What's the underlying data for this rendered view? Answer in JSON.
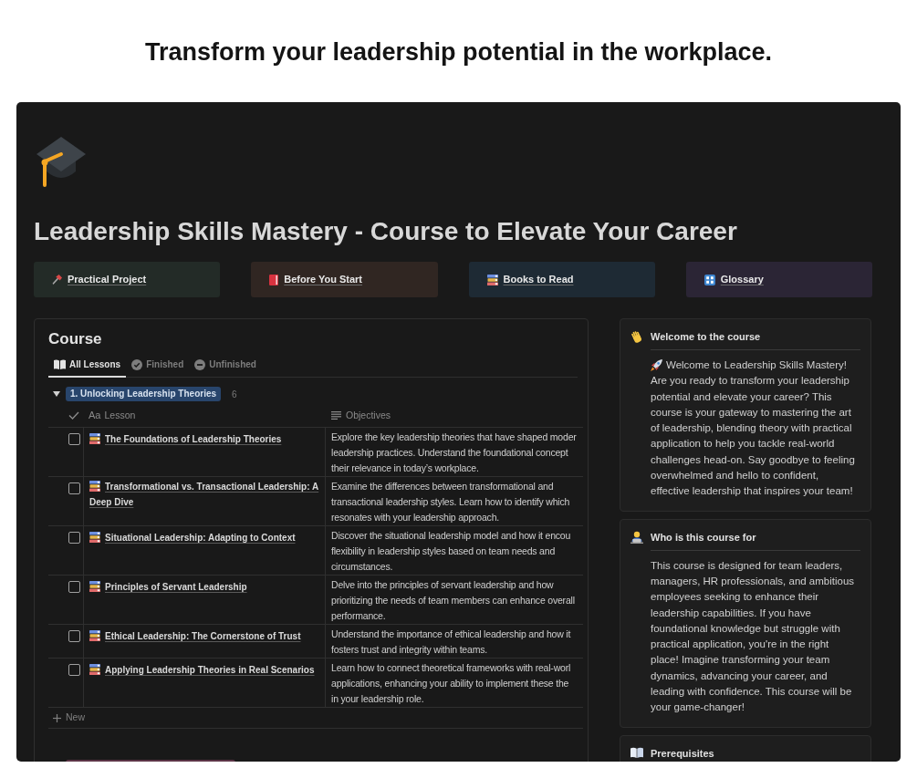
{
  "heading": "Transform your leadership potential in the workplace.",
  "title": "Leadership Skills Mastery - Course to Elevate Your Career",
  "links": [
    {
      "label": "Practical Project",
      "color": "#232b27"
    },
    {
      "label": "Before You Start",
      "color": "#302622"
    },
    {
      "label": "Books to Read",
      "color": "#1e2a34"
    },
    {
      "label": "Glossary",
      "color": "#2b2535"
    }
  ],
  "course": {
    "title": "Course",
    "tabs": [
      {
        "label": "All Lessons",
        "selected": true
      },
      {
        "label": "Finished",
        "selected": false
      },
      {
        "label": "Unfinished",
        "selected": false
      }
    ],
    "columns": [
      {
        "glyph": "Aa",
        "label": "Lesson"
      },
      {
        "label": "Objectives"
      }
    ],
    "groups": [
      {
        "label": "1. Unlocking Leadership Theories",
        "count": "6",
        "expanded": true,
        "color": "#28456c",
        "rows": [
          {
            "checked": false,
            "lesson": "The Foundations of Leadership Theories",
            "objectives": "Explore the key leadership theories that have shaped moder\nleadership practices. Understand the foundational concept\ntheir relevance in today’s workplace."
          },
          {
            "checked": false,
            "lesson": "Transformational vs. Transactional Leadership: A Deep Dive",
            "objectives": "Examine the differences between transformational and\ntransactional leadership styles. Learn how to identify which\nresonates with your leadership approach."
          },
          {
            "checked": false,
            "lesson": "Situational Leadership: Adapting to Context",
            "objectives": "Discover the situational leadership model and how it encou\nflexibility in leadership styles based on team needs and\ncircumstances."
          },
          {
            "checked": false,
            "lesson": "Principles of Servant Leadership",
            "objectives": "Delve into the principles of servant leadership and how\nprioritizing the needs of team members can enhance overall\nperformance."
          },
          {
            "checked": false,
            "lesson": "Ethical Leadership: The Cornerstone of Trust",
            "objectives": "Understand the importance of ethical leadership and how it\nfosters trust and integrity within teams."
          },
          {
            "checked": false,
            "lesson": "Applying Leadership Theories in Real Scenarios",
            "objectives": "Learn how to connect theoretical frameworks with real-worl\napplications, enhancing your ability to implement these the\nin your leadership role."
          }
        ]
      },
      {
        "color": "#5c3446"
      }
    ],
    "new_label": "New"
  },
  "callouts": [
    {
      "title": "Welcome to the course",
      "lead": "Welcome to Leadership Skills Mastery!",
      "body": "Are you ready to transform your leadership potential and elevate your career? This course is your gateway to mastering the art of leadership, blending theory with practical application to help you tackle real-world challenges head-on. Say goodbye to feeling overwhelmed and hello to confident, effective leadership that inspires your team!"
    },
    {
      "title": "Who is this course for",
      "body": "This course is designed for team leaders, managers, HR professionals, and ambitious employees seeking to enhance their leadership capabilities. If you have foundational knowledge but struggle with practical application, you're in the right place! Imagine transforming your team dynamics, advancing your career, and leading with confidence. This course will be your game-changer!"
    },
    {
      "title": "Prerequisites"
    }
  ]
}
